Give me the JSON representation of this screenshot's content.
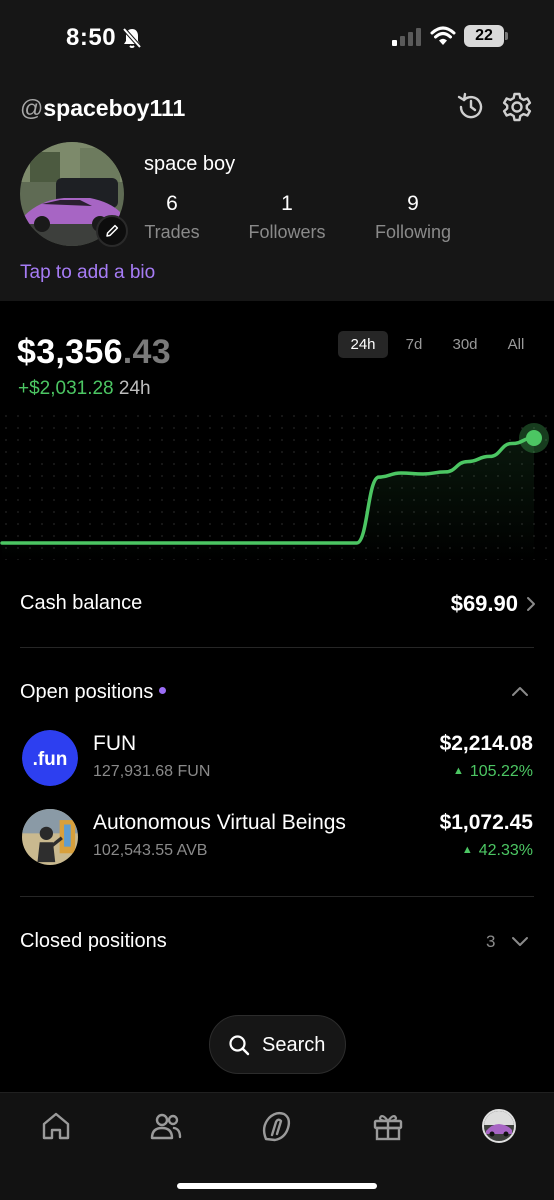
{
  "status_bar": {
    "time": "8:50",
    "battery": "22"
  },
  "profile": {
    "handle_prefix": "@",
    "handle": "spaceboy111",
    "display_name": "space boy",
    "stats": [
      {
        "value": "6",
        "label": "Trades"
      },
      {
        "value": "1",
        "label": "Followers"
      },
      {
        "value": "9",
        "label": "Following"
      }
    ],
    "bio_prompt": "Tap to add a bio"
  },
  "portfolio": {
    "value_dollars": "$3,356",
    "value_cents": ".43",
    "change_amount": "+$2,031.28",
    "change_period": "24h",
    "ranges": [
      "24h",
      "7d",
      "30d",
      "All"
    ],
    "active_range": "24h"
  },
  "chart_data": {
    "type": "line",
    "x": [
      0,
      2,
      4,
      6,
      8,
      10,
      12,
      14,
      16,
      17,
      18,
      19,
      20,
      21,
      22,
      23,
      24
    ],
    "values": [
      1325.15,
      1325.15,
      1325.15,
      1325.15,
      1325.15,
      1325.15,
      1325.15,
      1325.15,
      1325.15,
      2600,
      2680,
      2660,
      2700,
      2900,
      3000,
      3250,
      3356.43
    ],
    "color": "#4cc663",
    "grid": "dots",
    "title": "",
    "xlabel": "",
    "ylabel": ""
  },
  "cash": {
    "label": "Cash balance",
    "value": "$69.90"
  },
  "open_positions": {
    "label": "Open positions",
    "items": [
      {
        "logo_text": ".fun",
        "name": "FUN",
        "quantity": "127,931.68 FUN",
        "value": "$2,214.08",
        "change": "105.22%"
      },
      {
        "logo_text": "",
        "name": "Autonomous Virtual Beings",
        "quantity": "102,543.55 AVB",
        "value": "$1,072.45",
        "change": "42.33%"
      }
    ]
  },
  "closed_positions": {
    "label": "Closed positions",
    "count": "3"
  },
  "search": {
    "label": "Search"
  },
  "tabbar": {
    "tabs": [
      "home-icon",
      "people-icon",
      "brand-icon",
      "gift-icon",
      "profile-avatar"
    ]
  },
  "colors": {
    "accent_green": "#4cc663",
    "accent_purple": "#a67cf5",
    "background": "#000000"
  }
}
